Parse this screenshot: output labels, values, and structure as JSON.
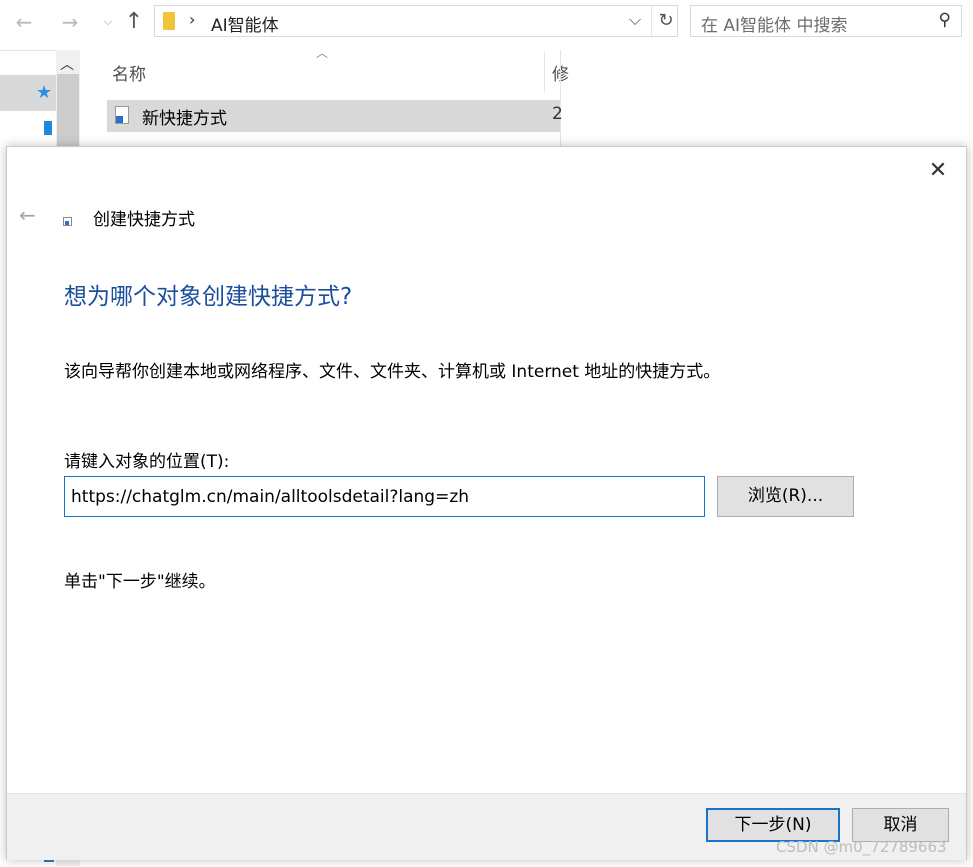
{
  "explorer": {
    "address_path": "AI智能体",
    "search_placeholder": "在 AI智能体 中搜索",
    "column_name": "名称",
    "column_next": "修",
    "file_name": "新快捷方式",
    "file_date": "2"
  },
  "dialog": {
    "wizard_title": "创建快捷方式",
    "heading": "想为哪个对象创建快捷方式?",
    "description": "该向导帮你创建本地或网络程序、文件、文件夹、计算机或 Internet 地址的快捷方式。",
    "location_label": "请键入对象的位置(T):",
    "location_value": "https://chatglm.cn/main/alltoolsdetail?lang=zh",
    "browse_label": "浏览(R)...",
    "hint": "单击\"下一步\"继续。",
    "next_label": "下一步(N)",
    "cancel_label": "取消"
  },
  "watermark": "CSDN @m0_72789663",
  "icons": [
    "back-arrow-icon",
    "forward-arrow-icon",
    "up-arrow-icon",
    "folder-icon",
    "refresh-icon",
    "search-icon",
    "star-icon",
    "shortcut-file-icon",
    "close-icon"
  ],
  "colors": {
    "heading": "#1a4f9c",
    "accent_border": "#1a73c8",
    "selection": "#d9d9d9"
  }
}
